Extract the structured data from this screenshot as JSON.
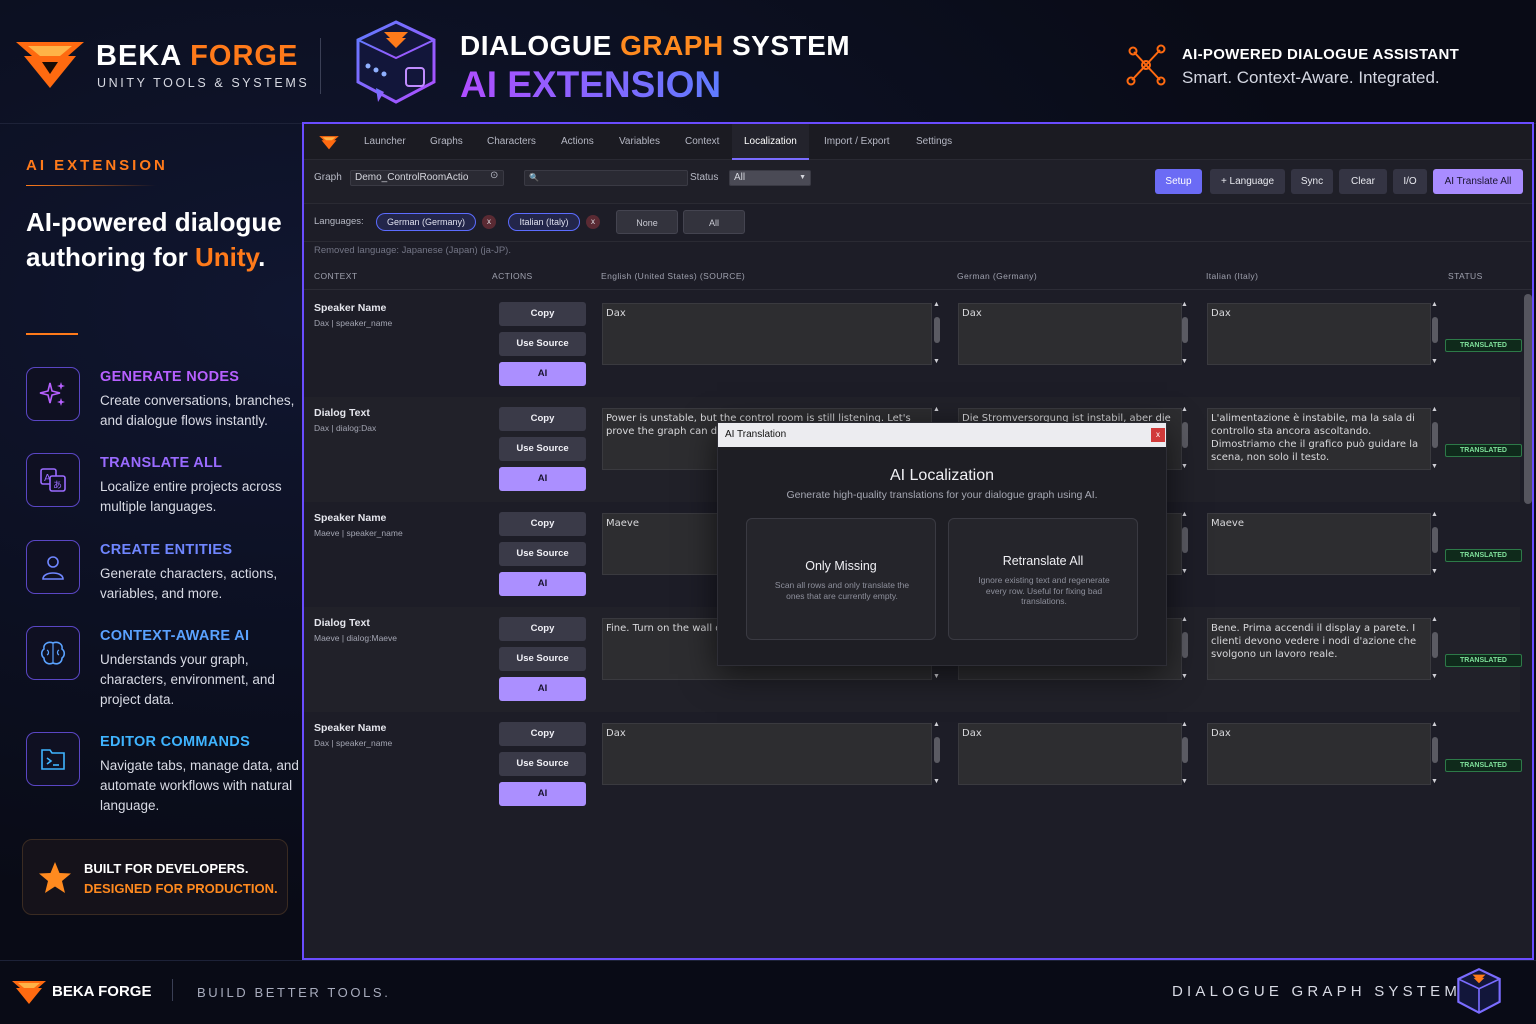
{
  "header": {
    "brand": {
      "name_a": "BEKA",
      "name_b": "FORGE",
      "subtitle": "UNITY TOOLS & SYSTEMS"
    },
    "title_a": "DIALOGUE",
    "title_b": "GRAPH",
    "title_c": "SYSTEM",
    "title2": "AI EXTENSION",
    "assistant_title": "AI-POWERED DIALOGUE ASSISTANT",
    "assistant_sub": "Smart. Context-Aware. Integrated."
  },
  "sidebar": {
    "label": "AI EXTENSION",
    "headline_a": "AI-powered dialogue authoring for ",
    "headline_b": "Unity",
    "headline_c": ".",
    "features": [
      {
        "title": "GENERATE NODES",
        "desc": "Create conversations, branches, and dialogue flows instantly.",
        "color": "#b760ff",
        "icon": "sparkle-icon"
      },
      {
        "title": "TRANSLATE ALL",
        "desc": "Localize entire projects across multiple languages.",
        "color": "#9a6bff",
        "icon": "translate-icon"
      },
      {
        "title": "CREATE ENTITIES",
        "desc": "Generate characters, actions, variables, and more.",
        "color": "#6f86ff",
        "icon": "person-icon"
      },
      {
        "title": "CONTEXT-AWARE AI",
        "desc": "Understands your graph, characters, environment, and project data.",
        "color": "#5aa2ff",
        "icon": "brain-icon"
      },
      {
        "title": "EDITOR COMMANDS",
        "desc": "Navigate tabs, manage data, and automate workflows with natural language.",
        "color": "#3fb4ff",
        "icon": "terminal-icon"
      }
    ],
    "built_a": "BUILT FOR DEVELOPERS.",
    "built_b": "DESIGNED FOR PRODUCTION."
  },
  "footer": {
    "brand": "BEKA FORGE",
    "tagline": "BUILD BETTER TOOLS.",
    "right": "DIALOGUE GRAPH SYSTEM"
  },
  "window": {
    "tabs": [
      "Launcher",
      "Graphs",
      "Characters",
      "Actions",
      "Variables",
      "Context",
      "Localization",
      "Import / Export",
      "Settings"
    ],
    "active_tab": "Localization",
    "toolbar": {
      "graph_label": "Graph",
      "graph_value": "Demo_ControlRoomActio",
      "search_value": "",
      "status_label": "Status",
      "status_value": "All",
      "buttons": [
        "Setup",
        "+ Language",
        "Sync",
        "Clear",
        "I/O",
        "AI Translate All"
      ]
    },
    "languages_label": "Languages:",
    "languages": [
      "German (Germany)",
      "Italian (Italy)"
    ],
    "lang_x": "x",
    "lang_none": "None",
    "lang_all": "All",
    "removed": "Removed language: Japanese (Japan) (ja-JP).",
    "columns": [
      "CONTEXT",
      "ACTIONS",
      "English (United States) (SOURCE)",
      "German (Germany)",
      "Italian (Italy)",
      "STATUS"
    ],
    "action_labels": {
      "copy": "Copy",
      "use_source": "Use Source",
      "ai": "AI"
    },
    "rows": [
      {
        "title": "Speaker Name",
        "sub": "Dax | speaker_name",
        "en": "Dax",
        "de": "Dax",
        "it": "Dax",
        "status": "TRANSLATED"
      },
      {
        "title": "Dialog Text",
        "sub": "Dax | dialog:Dax",
        "en": "Power is unstable, but the control room is still listening. Let's prove the graph can drive",
        "de": "Die Stromversorgung ist instabil, aber die",
        "it": "L'alimentazione è instabile, ma la sala di controllo sta ancora ascoltando. Dimostriamo che il grafico può guidare la scena, non solo il testo.",
        "status": "TRANSLATED"
      },
      {
        "title": "Speaker Name",
        "sub": "Maeve | speaker_name",
        "en": "Maeve",
        "de": "",
        "it": "Maeve",
        "status": "TRANSLATED"
      },
      {
        "title": "Dialog Text",
        "sub": "Maeve | dialog:Maeve",
        "en": "Fine. Turn on the wall display. action nodes doing real",
        "de": "n,",
        "it": "Bene. Prima accendi il display a parete. I clienti devono vedere i nodi d'azione che svolgono un lavoro reale.",
        "status": "TRANSLATED"
      },
      {
        "title": "Speaker Name",
        "sub": "Dax | speaker_name",
        "en": "Dax",
        "de": "Dax",
        "it": "Dax",
        "status": "TRANSLATED"
      }
    ],
    "modal": {
      "window_title": "AI Translation",
      "close": "x",
      "heading": "AI Localization",
      "sub": "Generate high-quality translations for your dialogue graph using AI.",
      "option1_title": "Only Missing",
      "option1_desc": "Scan all rows and only translate the ones that are currently empty.",
      "option2_title": "Retranslate All",
      "option2_desc": "Ignore existing text and regenerate every row. Useful for fixing bad translations."
    }
  }
}
